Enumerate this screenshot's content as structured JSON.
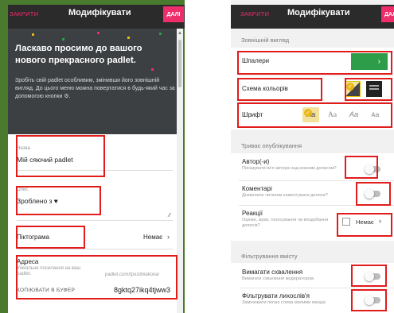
{
  "left_panel": {
    "close_label": "ЗАКРИТИ",
    "title": "Модифікувати",
    "next_label": "ДАЛІ",
    "headline": "Ласкаво просимо до вашого нового прекрасного padlet.",
    "intro": "Зробіть свій padlet особливим, змінивши його зовнішній вигляд. До цього меню можна повертатися в будь-який час за допомогою кнопки ⚙.",
    "title_field": {
      "label": "Назва",
      "value": "Мій сяючий padlet"
    },
    "description_field": {
      "label": "Опис",
      "value": "Зроблено з ♥"
    },
    "icon_row": {
      "label": "Піктограма",
      "value": "Немає"
    },
    "address": {
      "label": "Адреса",
      "hint": "Унікальне посилання на ваш padlet.",
      "base_url": "padlet.com/tpozdniakova/",
      "copy_label": "КОПІЮВАТИ В БУФЕР",
      "slug": "8gktq27ikq4tjww3"
    }
  },
  "right_panel": {
    "close_label": "ЗАКРИТИ",
    "title": "Модифікувати",
    "next_label": "ДАЛІ",
    "appearance": {
      "section_title": "Зовнішній вигляд",
      "wallpaper_label": "Шпалери",
      "color_scheme_label": "Схема кольорів",
      "font_label": "Шрифт",
      "font_options": [
        "Aa",
        "Aa",
        "Aa",
        "Aa"
      ]
    },
    "publishing": {
      "section_title": "Триває опублікування",
      "author": {
        "label": "Автор(-и)",
        "hint": "Показувати ім'я автора над кожним дописом?",
        "enabled": false
      },
      "comments": {
        "label": "Коментарі",
        "hint": "Дозволити читачам коментувати дописи?",
        "enabled": false
      },
      "reactions": {
        "label": "Реакції",
        "hint": "Оцінки, зірки, голосування чи вподобання дописів?",
        "value": "Немає"
      }
    },
    "filtering": {
      "section_title": "Фільтрування вмісту",
      "approval": {
        "label": "Вимагати схвалення",
        "hint": "Вимагати схвалення модератором.",
        "enabled": false
      },
      "profanity": {
        "label": "Фільтрувати лихослів'я",
        "hint": "Замінювати погані слова милими емодзі.",
        "enabled": false
      }
    }
  },
  "colors": {
    "accent_pink": "#ee2e6b",
    "header_dark": "#2b2b2b",
    "hero_dark": "#3d4043",
    "side_green": "#4a7a2e",
    "wallpaper_green": "#2e9d49",
    "annotation_red": "#e21b1b",
    "font_selected": "#f3e19a",
    "check_yellow": "#e8b714"
  },
  "icons": [
    "settings-gear-icon",
    "heart-icon",
    "chevron-right-icon",
    "checkmark-icon",
    "resize-handle-icon",
    "scroll-up-arrow-icon"
  ]
}
